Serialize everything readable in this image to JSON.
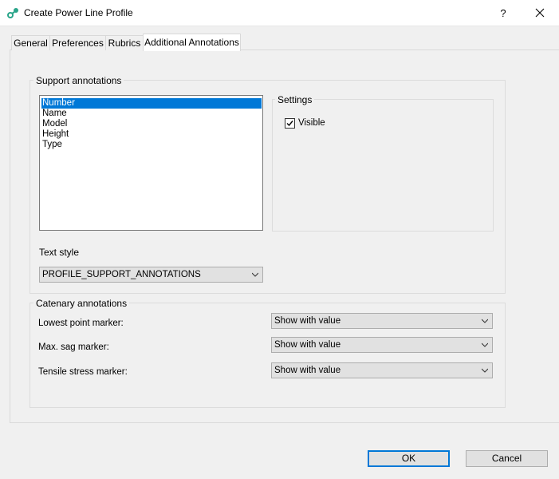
{
  "window": {
    "title": "Create Power Line Profile",
    "help_label": "?",
    "icons": {
      "app": "power-line-profile-icon",
      "close": "close-icon"
    }
  },
  "tabs": [
    {
      "label": "General",
      "active": false
    },
    {
      "label": "Preferences",
      "active": false
    },
    {
      "label": "Rubrics",
      "active": false
    },
    {
      "label": "Additional Annotations",
      "active": true
    }
  ],
  "support_annotations": {
    "group_label": "Support annotations",
    "items": [
      "Number",
      "Name",
      "Model",
      "Height",
      "Type"
    ],
    "selected_index": 0,
    "settings": {
      "group_label": "Settings",
      "visible_label": "Visible",
      "visible_checked": true
    },
    "text_style": {
      "label": "Text style",
      "value": "PROFILE_SUPPORT_ANNOTATIONS"
    }
  },
  "catenary_annotations": {
    "group_label": "Catenary annotations",
    "rows": [
      {
        "label": "Lowest point marker:",
        "value": "Show with value"
      },
      {
        "label": "Max. sag marker:",
        "value": "Show with value"
      },
      {
        "label": "Tensile stress marker:",
        "value": "Show with value"
      }
    ]
  },
  "buttons": {
    "ok": "OK",
    "cancel": "Cancel"
  },
  "colors": {
    "selection": "#0078d7",
    "default_button_border": "#0078d7"
  }
}
